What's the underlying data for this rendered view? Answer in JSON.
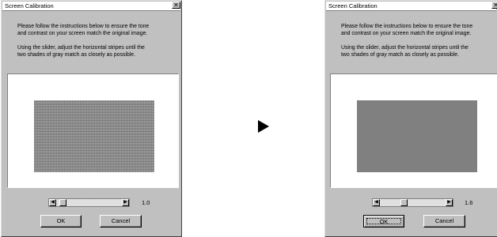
{
  "dialogs": [
    {
      "title": "Screen Calibration",
      "close_glyph": "✕",
      "instructions": [
        "Please follow the instructions below to ensure the tone",
        "and contrast on your screen match the original image.",
        "Using the slider, adjust the horizontal stripes until the",
        "two shades of gray match as closely as possible."
      ],
      "slider": {
        "value_label": "1.0",
        "left_arrow": "◀",
        "right_arrow": "▶",
        "level": 0.05
      },
      "ok_label": "OK",
      "cancel_label": "Cancel"
    },
    {
      "title": "Screen Calibration",
      "close_glyph": "✕",
      "instructions": [
        "Please follow the instructions below to ensure the tone",
        "and contrast on your screen match the original image.",
        "Using the slider, adjust the horizontal stripes until the",
        "two shades of gray match as closely as possible."
      ],
      "slider": {
        "value_label": "1.6",
        "left_arrow": "◀",
        "right_arrow": "▶",
        "level": 0.35
      },
      "ok_label": "OK",
      "cancel_label": "Cancel"
    }
  ],
  "colors": {
    "dialog_face": "#c0c0c0",
    "matched_gray": "#808080"
  },
  "icons": {
    "transition": "arrow-right-icon"
  }
}
